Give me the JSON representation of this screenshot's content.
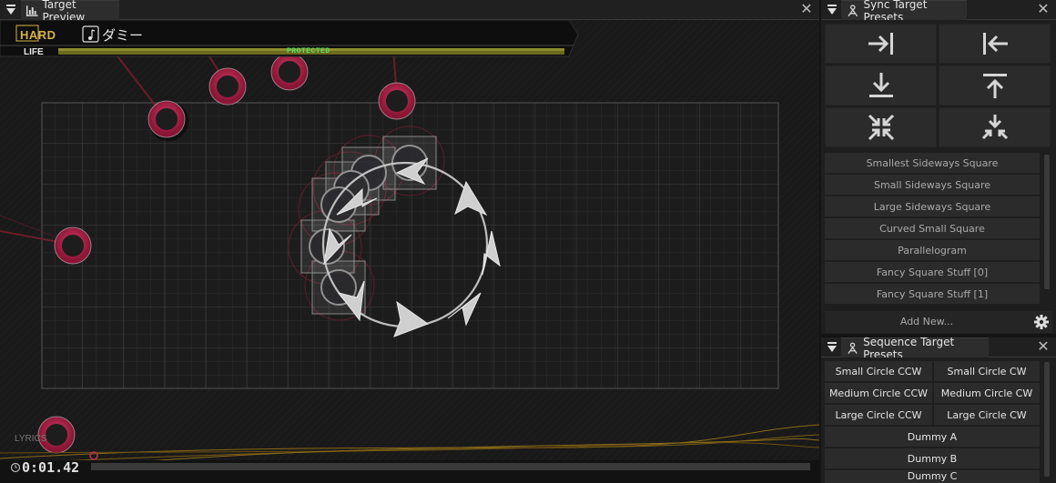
{
  "preview_panel": {
    "tab_title": "Target Preview",
    "difficulty": "HARD",
    "song_name": "ダミー",
    "life_label": "LIFE",
    "protected_label": "PROTECTED",
    "lyrics_label": "LYRICS",
    "timer": "0:01.42",
    "icons": [
      "bar-chart-icon",
      "note-icon",
      "clock-icon",
      "close-icon"
    ]
  },
  "sync_panel": {
    "tab_title": "Sync Target Presets",
    "arrange_buttons": [
      "align-right-icon",
      "align-left-icon",
      "align-bottom-icon",
      "align-top-icon",
      "compress-icon",
      "stack-icon"
    ],
    "presets": [
      "Smallest Sideways Square",
      "Small Sideways Square",
      "Large Sideways Square",
      "Curved Small Square",
      "Parallelogram",
      "Fancy Square Stuff [0]",
      "Fancy Square Stuff [1]"
    ],
    "add_new_label": "Add New..."
  },
  "sequence_panel": {
    "tab_title": "Sequence Target Presets",
    "grid_buttons": [
      "Small Circle CCW",
      "Small Circle CW",
      "Medium Circle CCW",
      "Medium Circle CW",
      "Large Circle CCW",
      "Large Circle CW"
    ],
    "wide_buttons": [
      "Dummy A",
      "Dummy B",
      "Dummy C"
    ]
  },
  "colors": {
    "accent_pink": "#b0224a",
    "panel_bg": "#1e1e1e",
    "button_bg": "#2b2b2b",
    "protected_green": "#56e06a",
    "difficulty_gold": "#d6b246"
  }
}
